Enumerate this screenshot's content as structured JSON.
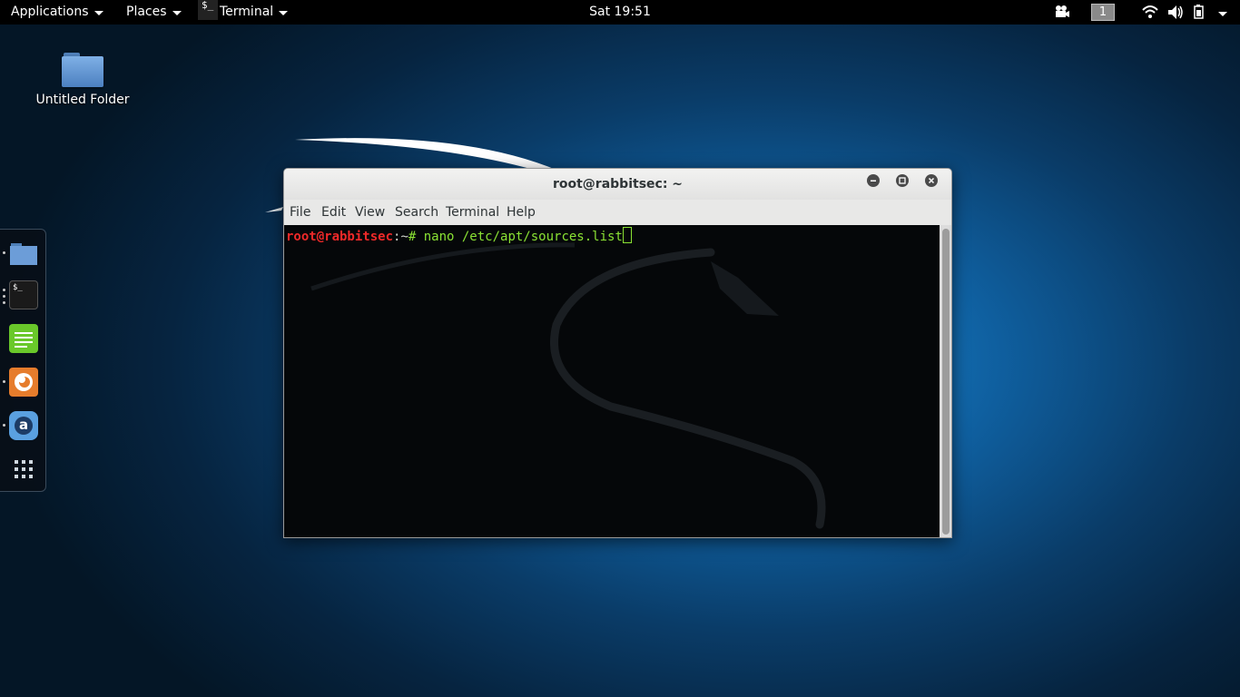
{
  "topbar": {
    "applications": "Applications",
    "places": "Places",
    "active_app": "Terminal",
    "active_app_icon_text": "$_",
    "clock": "Sat 19:51",
    "workspace": "1"
  },
  "desktop": {
    "icons": [
      {
        "label": "Untitled Folder"
      }
    ]
  },
  "dock": {
    "items": [
      {
        "name": "files"
      },
      {
        "name": "terminal",
        "glyph": "$_"
      },
      {
        "name": "text-editor"
      },
      {
        "name": "firefox"
      },
      {
        "name": "software-center",
        "glyph": "a"
      },
      {
        "name": "show-applications"
      }
    ]
  },
  "window": {
    "title": "root@rabbitsec: ~",
    "menu": [
      "File",
      "Edit",
      "View",
      "Search",
      "Terminal",
      "Help"
    ],
    "prompt_user": "root@rabbitsec",
    "prompt_path": ":~",
    "prompt_symbol": "# ",
    "command": "nano /etc/apt/sources.list"
  },
  "colors": {
    "prompt_user": "#ef2929",
    "prompt_cmd": "#8ae234",
    "terminal_bg": "#050709"
  }
}
